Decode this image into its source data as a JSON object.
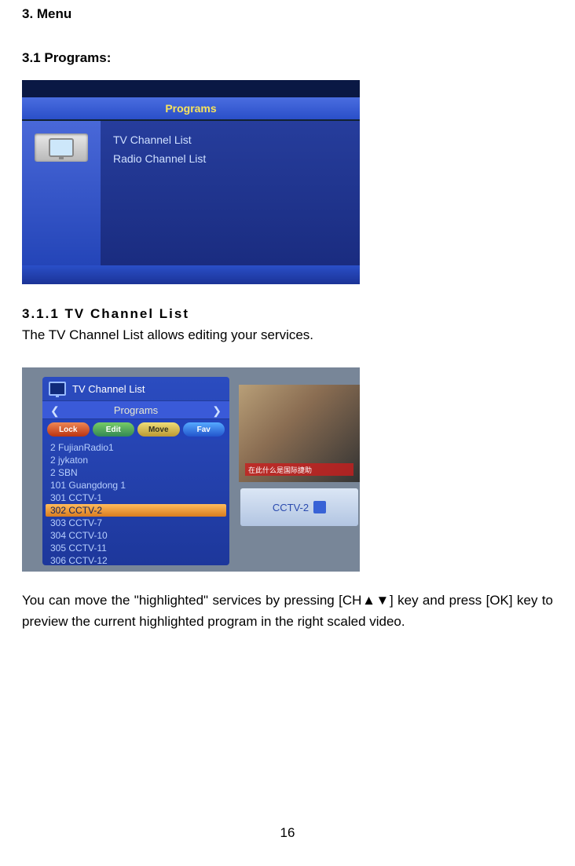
{
  "h1": "3.  Menu",
  "h2": "3.1    Programs:",
  "h3": "3.1.1    TV  Channel  List",
  "p1": "The TV Channel List allows editing your services.",
  "p2": "You can move the \"highlighted\" services by pressing [CH▲▼] key and press [OK] key to preview the current highlighted program in the right scaled video.",
  "page_number": "16",
  "shot1": {
    "title": "Programs",
    "items": [
      "TV Channel List",
      "Radio Channel List"
    ]
  },
  "shot2": {
    "header": "TV Channel List",
    "subheader": "Programs",
    "pills": {
      "lock": "Lock",
      "edit": "Edit",
      "move": "Move",
      "fav": "Fav"
    },
    "channels": [
      {
        "num": "2",
        "name": "FujianRadio1"
      },
      {
        "num": "2",
        "name": "jykaton"
      },
      {
        "num": "2",
        "name": "SBN"
      },
      {
        "num": "101",
        "name": "Guangdong 1"
      },
      {
        "num": "301",
        "name": "CCTV-1"
      },
      {
        "num": "302",
        "name": "CCTV-2"
      },
      {
        "num": "303",
        "name": "CCTV-7"
      },
      {
        "num": "304",
        "name": "CCTV-10"
      },
      {
        "num": "305",
        "name": "CCTV-11"
      },
      {
        "num": "306",
        "name": "CCTV-12"
      }
    ],
    "highlighted_index": 5,
    "preview_label": "CCTV-2",
    "overlay": "在此什么是国际捷助"
  }
}
